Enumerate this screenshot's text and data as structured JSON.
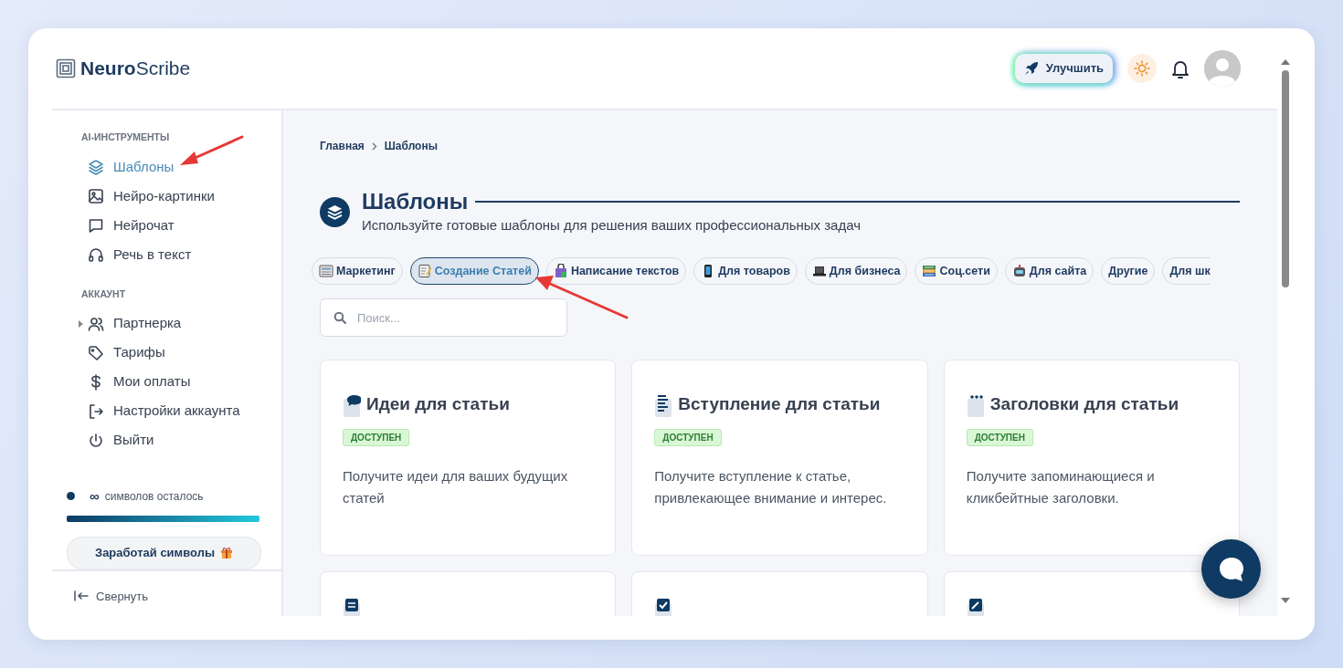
{
  "brand": {
    "name": "**Neuro**Scribe"
  },
  "header": {
    "upgrade_button": "Улучшить"
  },
  "sidebar": {
    "sections": [
      {
        "heading": "AI-ИНСТРУМЕНТЫ",
        "items": [
          {
            "label": "Шаблоны",
            "kind": "link",
            "selected": true
          },
          {
            "label": "Нейро-картинки",
            "kind": "link",
            "selected": false
          },
          {
            "label": "Нейрочат",
            "kind": "link",
            "selected": false
          },
          {
            "label": "Речь в текст",
            "kind": "link",
            "selected": false
          }
        ]
      },
      {
        "heading": "АККАУНТ",
        "items": [
          {
            "label": "Партнерка",
            "kind": "group",
            "selected": false
          },
          {
            "label": "Тарифы",
            "kind": "link",
            "selected": false
          },
          {
            "label": "Мои оплаты",
            "kind": "link",
            "selected": false
          },
          {
            "label": "Настройки аккаунта",
            "kind": "link",
            "selected": false
          },
          {
            "label": "Выйти",
            "kind": "link",
            "selected": false
          }
        ]
      }
    ],
    "credits": {
      "amount": "∞",
      "label": "символов осталось",
      "level": 1,
      "color": "#0e3a63"
    },
    "earn_button": "Заработай символы",
    "collapse": "Свернуть"
  },
  "main": {
    "breadcrumb": [
      "Главная",
      "Шаблоны"
    ],
    "title": "Шаблоны",
    "subtitle": "Используйте готовые шаблоны для решения ваших профессиональных задач",
    "chips": [
      {
        "label": "Маркетинг",
        "selected": false
      },
      {
        "label": "Создание Статей",
        "selected": true
      },
      {
        "label": "Написание текстов",
        "selected": false
      },
      {
        "label": "Для товаров",
        "selected": false
      },
      {
        "label": "Для бизнеса",
        "selected": false
      },
      {
        "label": "Соц.сети",
        "selected": false
      },
      {
        "label": "Для сайта",
        "selected": false
      },
      {
        "label": "Другие",
        "selected": false
      },
      {
        "label": "Для шк",
        "selected": false
      }
    ],
    "search": {
      "placeholder": "Поиск..."
    },
    "cards": [
      {
        "title": "Идеи для статьи",
        "badge": "ДОСТУПЕН",
        "description": "Получите идеи для ваших будущих статей"
      },
      {
        "title": "Вступление для статьи",
        "badge": "ДОСТУПЕН",
        "description": "Получите вступление к статье, привлекающее внимание и интерес."
      },
      {
        "title": "Заголовки для статьи",
        "badge": "ДОСТУПЕН",
        "description": "Получите запоминающиеся и кликбейтные заголовки."
      },
      {
        "kind": "partial"
      },
      {
        "kind": "partial"
      },
      {
        "kind": "partial"
      }
    ]
  }
}
